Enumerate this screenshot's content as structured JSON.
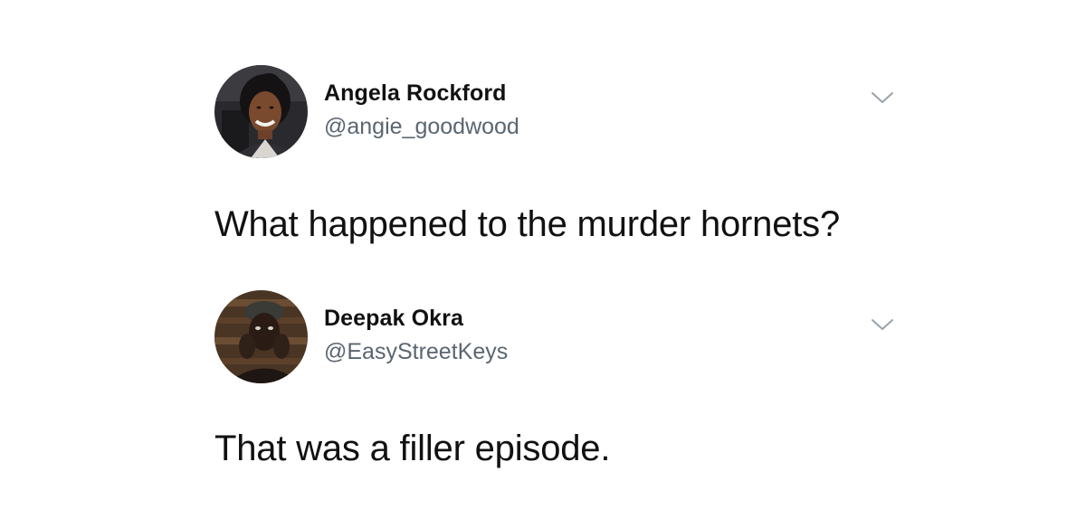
{
  "tweets": [
    {
      "display_name": "Angela Rockford",
      "handle": "@angie_goodwood",
      "text": "What happened to the murder hornets?",
      "avatar_icon": "profile-photo-woman",
      "menu_icon": "chevron-down-icon"
    },
    {
      "display_name": "Deepak Okra",
      "handle": "@EasyStreetKeys",
      "text": "That was a filler episode.",
      "avatar_icon": "profile-photo-man",
      "menu_icon": "chevron-down-icon"
    }
  ],
  "colors": {
    "background": "#ffffff",
    "text": "#111111",
    "handle": "#5b6670",
    "chevron": "#9aa3ab"
  }
}
